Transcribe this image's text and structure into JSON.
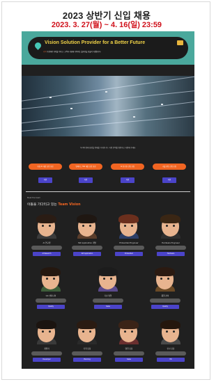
{
  "header": {
    "title": "2023 상반기 신입 채용",
    "date_range": "2023. 3. 27(월) ~ 4. 16(일) 23:59"
  },
  "banner": {
    "title": "Vision Solution Provider for a Better Future",
    "subtitle_highlight": "가치",
    "subtitle": "수집에서 가치를 더하고, 고객과 사회에 기여하는 솔루션을 만들어 가겠습니다."
  },
  "intro_text": "우리와 함께 성장할 인재를 기다립니다. 지원 분야를 확인하고 지원해 주세요.",
  "apply_buttons": [
    {
      "label": "영상 AI 개발 신입 모집"
    },
    {
      "label": "임베디드 SW 개발 신입 모집"
    },
    {
      "label": "AI 연구원 신입 모집"
    },
    {
      "label": "기술 영업 신입 모집"
    }
  ],
  "small_buttons": [
    "지원",
    "지원",
    "지원",
    "지원"
  ],
  "team_section": {
    "label": "Meet the team",
    "title_prefix": "이들을 기다리고 있는",
    "title_accent": "Team Vision"
  },
  "team_members": [
    {
      "role": "AI 연구원",
      "tag": "AI Research",
      "hair": "#2a1c14",
      "body": "#3b3b3b"
    },
    {
      "role": "SW Application 개발",
      "tag": "SW Application",
      "hair": "#1f1712",
      "body": "#5a3d2b"
    },
    {
      "role": "Embedded Engineer",
      "tag": "Embedded",
      "hair": "#6b2f1d",
      "body": "#2c3e66"
    },
    {
      "role": "Hardware Engineer",
      "tag": "Hardware",
      "hair": "#3a2614",
      "body": "#2e2e2e"
    },
    {
      "role": "QA 엔지니어",
      "tag": "Quality",
      "hair": "#24170f",
      "body": "#3e5e3a"
    },
    {
      "role": "기술 영업",
      "tag": "Sales",
      "hair": "#1c1c1c",
      "body": "#5b4a8c"
    },
    {
      "role": "품질 관리",
      "tag": "Quality",
      "hair": "#2b1a11",
      "body": "#6b4a26"
    },
    {
      "role": "개발자",
      "tag": "Developer",
      "hair": "#1b1410",
      "body": "#3a3a3a"
    },
    {
      "role": "기획 담당",
      "tag": "Planning",
      "hair": "#2a1b12",
      "body": "#2a2a2a"
    },
    {
      "role": "영업 담당",
      "tag": "Sales",
      "hair": "#3a2317",
      "body": "#6a2f2f"
    },
    {
      "role": "인사 담당",
      "tag": "HR",
      "hair": "#24160d",
      "body": "#4a4a4a"
    }
  ],
  "colors": {
    "accent_orange": "#f16522",
    "accent_purple": "#4b44c9",
    "banner_teal": "#4aa89c",
    "title_red": "#d0101a"
  }
}
